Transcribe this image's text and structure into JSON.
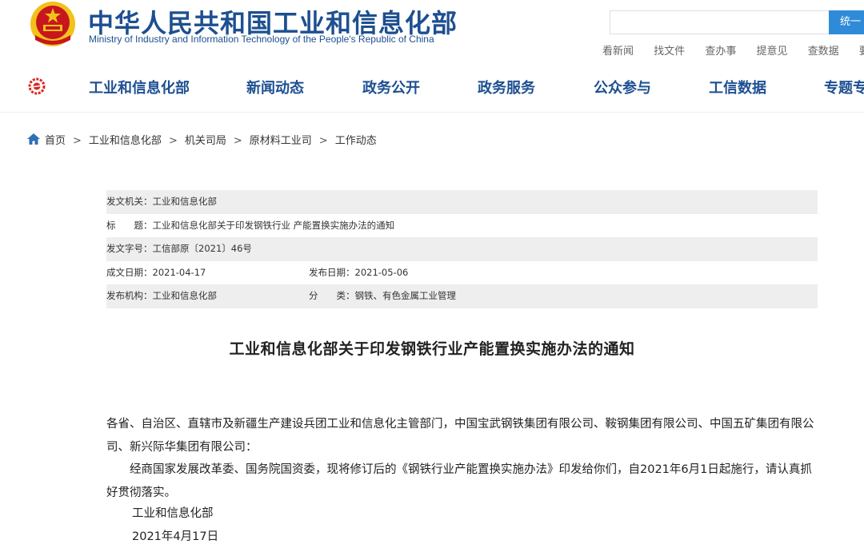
{
  "header": {
    "title": "中华人民共和国工业和信息化部",
    "subtitle": "Ministry of Industry and Information Technology of the People's Republic of China",
    "search_button": "统一",
    "quick_links": [
      "看新闻",
      "找文件",
      "查办事",
      "提意见",
      "查数据",
      "要"
    ]
  },
  "nav": {
    "items": [
      "工业和信息化部",
      "新闻动态",
      "政务公开",
      "政务服务",
      "公众参与",
      "工信数据",
      "专题专"
    ]
  },
  "breadcrumb": [
    "首页",
    "工业和信息化部",
    "机关司局",
    "原材料工业司",
    "工作动态"
  ],
  "meta": {
    "issuer_label": "发文机关：",
    "issuer_value": "工业和信息化部",
    "title_label": "标　　题：",
    "title_value": "工业和信息化部关于印发钢铁行业 产能置换实施办法的通知",
    "docno_label": "发文字号：",
    "docno_value": "工信部原〔2021〕46号",
    "written_label": "成文日期：",
    "written_value": "2021-04-17",
    "published_label": "发布日期：",
    "published_value": "2021-05-06",
    "publisher_label": "发布机构：",
    "publisher_value": "工业和信息化部",
    "category_label": "分　　类：",
    "category_value": "钢铁、有色金属工业管理"
  },
  "document": {
    "title": "工业和信息化部关于印发钢铁行业产能置换实施办法的通知",
    "paragraph1": "各省、自治区、直辖市及新疆生产建设兵团工业和信息化主管部门，中国宝武钢铁集团有限公司、鞍钢集团有限公司、中国五矿集团有限公司、新兴际华集团有限公司：",
    "paragraph2": "经商国家发展改革委、国务院国资委，现将修订后的《钢铁行业产能置换实施办法》印发给你们，自2021年6月1日起施行，请认真抓好贯彻落实。",
    "signature": "工业和信息化部",
    "date": "2021年4月17日"
  },
  "colors": {
    "brand_blue": "#1d4f91",
    "button_blue": "#2f8bd8",
    "emblem_red": "#c8161d",
    "emblem_gold": "#f2c21b"
  }
}
